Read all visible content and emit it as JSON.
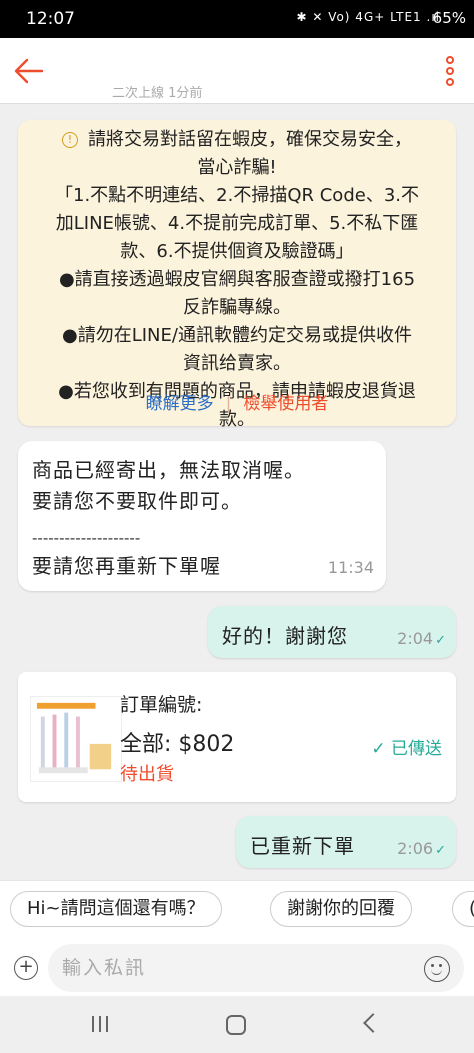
{
  "status_bar": {
    "time": "12:07",
    "icons": "✱ ✕ Vo) 4G+ LTE1 .ıl",
    "battery": "65%"
  },
  "header": {
    "subtitle": "二次上線 1分前"
  },
  "notice": {
    "line1": "請將交易對話留在蝦皮，確保交易安全，",
    "line2": "當心詐騙!",
    "line3": "「1.不點不明連结、2.不掃描QR Code、3.不",
    "line4": "加LINE帳號、4.不提前完成訂單、5.不私下匯",
    "line5": "款、6.不提供個資及驗證碼」",
    "line6": "●請直接透過蝦皮官網與客服查證或撥打165",
    "line7": "反詐騙專線。",
    "line8": "●請勿在LINE/通訊軟體约定交易或提供收件",
    "line9": "資訊给賣家。",
    "line10": "●若您收到有問題的商品，請申請蝦皮退貨退",
    "line11": "款。",
    "learn_more": "瞭解更多",
    "separator": "|",
    "report": "檢舉使用者"
  },
  "messages": {
    "incoming": {
      "line1": "商品已經寄出，無法取消喔。",
      "line2": "要請您不要取件即可。",
      "divider": "--------------------",
      "line3": "要請您再重新下單喔",
      "time": "11:34"
    },
    "outgoing1": {
      "text": "好的！謝謝您",
      "time": "2:04",
      "check": "✓"
    },
    "order": {
      "order_label": "訂單編號:",
      "total": "全部: $802",
      "status": "待出貨",
      "sent": "✓ 已傳送"
    },
    "outgoing2": {
      "text": "已重新下單",
      "time": "2:06",
      "check": "✓"
    }
  },
  "quick_replies": [
    "Hi~請問這個還有嗎？",
    "謝謝你的回覆",
    "("
  ],
  "composer": {
    "placeholder": "輸入私訊",
    "plus": "+"
  },
  "colors": {
    "brand": "#ee4d2d",
    "sent_bubble": "#d8f2ec",
    "notice_bg": "#fcf3dc",
    "teal": "#26aa99"
  }
}
